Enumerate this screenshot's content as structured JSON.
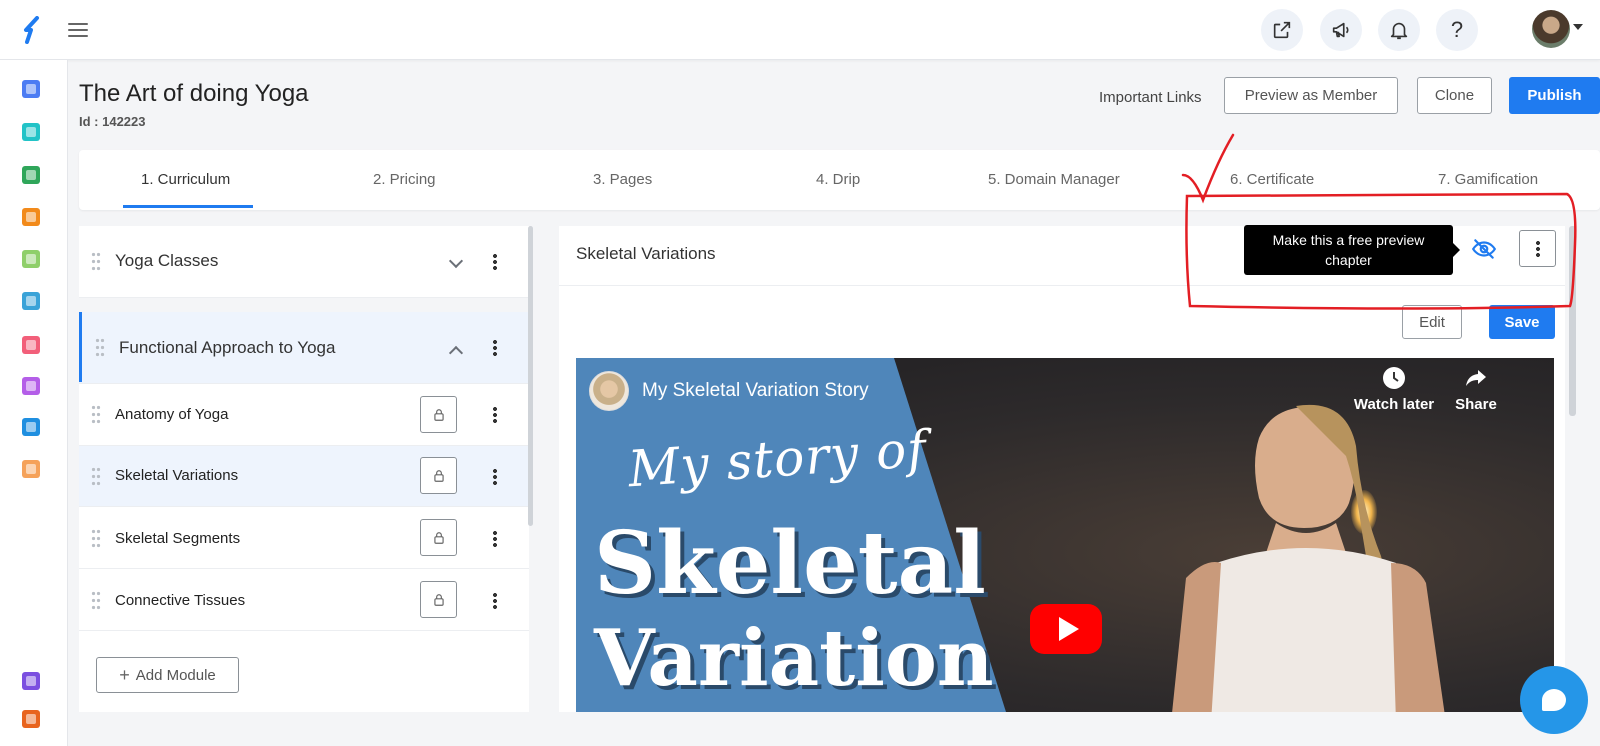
{
  "colors": {
    "accent": "#1f7bf0",
    "annotation": "#e31e24"
  },
  "topbar": {
    "icons": [
      "external-link-icon",
      "megaphone-icon",
      "bell-icon",
      "help-icon"
    ],
    "help_glyph": "?"
  },
  "sidebar": {
    "icons": [
      "dashboard-icon",
      "users-icon",
      "globe-icon",
      "book-icon",
      "grid-icon",
      "chart-icon",
      "star-icon",
      "settings-icon",
      "pie-icon",
      "apps-icon",
      "calendar-icon",
      "gift-icon"
    ]
  },
  "header": {
    "title": "The Art of doing Yoga",
    "id_label": "Id : 142223",
    "important_links": "Important Links",
    "preview_label": "Preview as Member",
    "clone_label": "Clone",
    "publish_label": "Publish"
  },
  "tabs": [
    {
      "label": "1. Curriculum",
      "active": true
    },
    {
      "label": "2. Pricing"
    },
    {
      "label": "3. Pages"
    },
    {
      "label": "4. Drip"
    },
    {
      "label": "5. Domain Manager"
    },
    {
      "label": "6. Certificate"
    },
    {
      "label": "7. Gamification"
    }
  ],
  "curriculum": {
    "modules": [
      {
        "label": "Yoga Classes",
        "expanded": false
      },
      {
        "label": "Functional Approach to Yoga",
        "expanded": true
      }
    ],
    "chapters": [
      {
        "label": "Anatomy of Yoga"
      },
      {
        "label": "Skeletal Variations",
        "selected": true
      },
      {
        "label": "Skeletal Segments"
      },
      {
        "label": "Connective Tissues"
      }
    ],
    "add_module_label": "Add Module"
  },
  "chapter_detail": {
    "title": "Skeletal Variations",
    "tooltip": "Make this a free preview chapter",
    "edit_label": "Edit",
    "save_label": "Save"
  },
  "video": {
    "title": "My Skeletal Variation Story",
    "watch_later": "Watch later",
    "share": "Share",
    "script_text": "My story of",
    "big_text_1": "Skeletal",
    "big_text_2": "Variation"
  }
}
